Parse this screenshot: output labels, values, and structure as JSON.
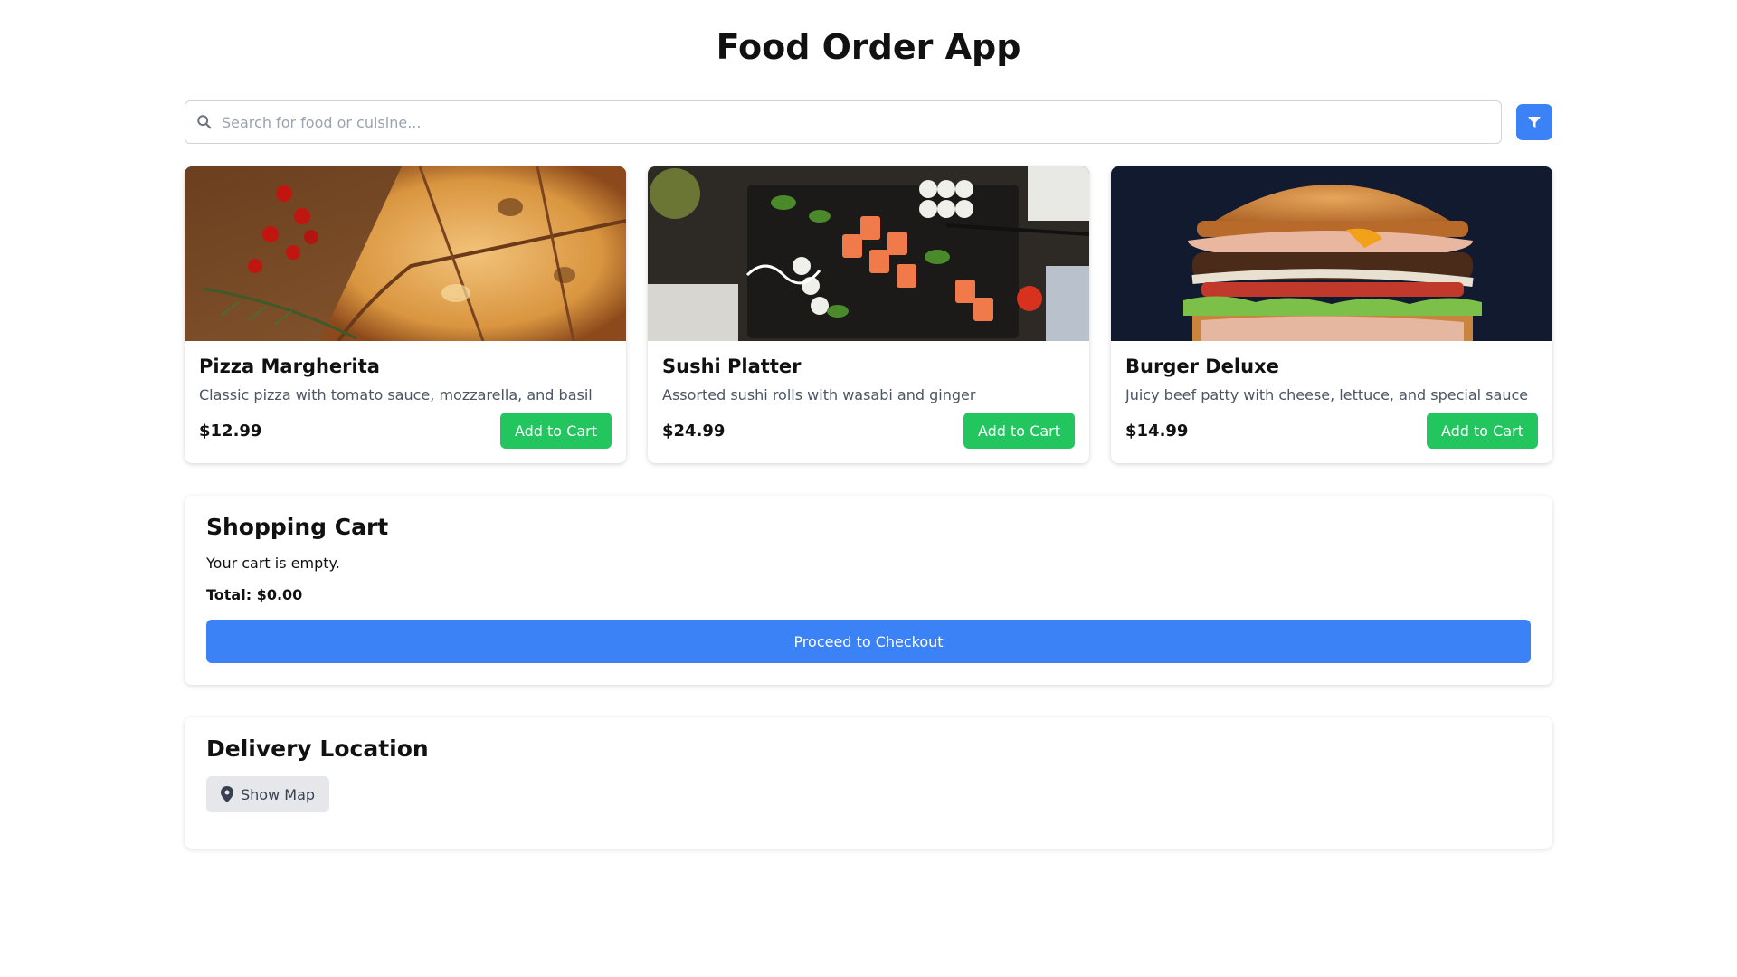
{
  "app": {
    "title": "Food Order App"
  },
  "search": {
    "placeholder": "Search for food or cuisine..."
  },
  "menu": {
    "items": [
      {
        "name": "Pizza Margherita",
        "description": "Classic pizza with tomato sauce, mozzarella, and basil",
        "price": "$12.99",
        "button_label": "Add to Cart"
      },
      {
        "name": "Sushi Platter",
        "description": "Assorted sushi rolls with wasabi and ginger",
        "price": "$24.99",
        "button_label": "Add to Cart"
      },
      {
        "name": "Burger Deluxe",
        "description": "Juicy beef patty with cheese, lettuce, and special sauce",
        "price": "$14.99",
        "button_label": "Add to Cart"
      }
    ]
  },
  "cart": {
    "title": "Shopping Cart",
    "empty_message": "Your cart is empty.",
    "total_label": "Total: $0.00",
    "checkout_label": "Proceed to Checkout"
  },
  "delivery": {
    "title": "Delivery Location",
    "map_button_label": "Show Map"
  },
  "colors": {
    "primary": "#3b82f6",
    "success": "#22c55e",
    "muted_button": "#e5e7eb"
  },
  "icons": {
    "search": "search-icon",
    "filter": "filter-icon",
    "location": "map-pin-icon"
  }
}
